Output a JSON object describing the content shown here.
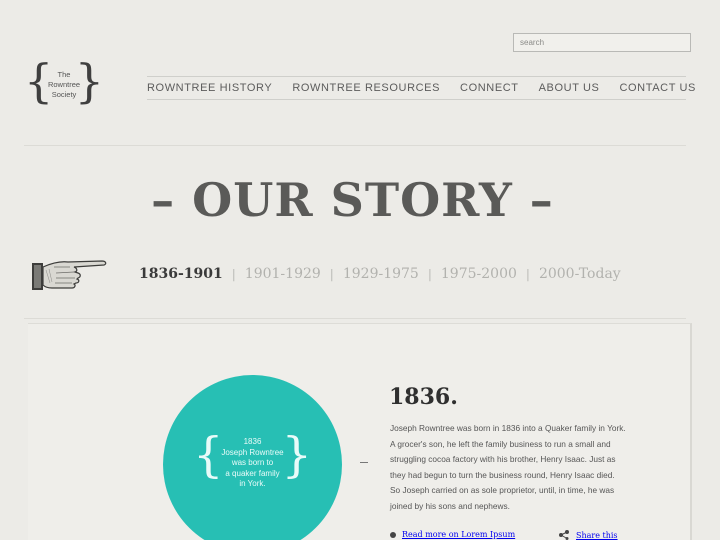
{
  "search": {
    "placeholder": "search"
  },
  "logo": {
    "line1": "The",
    "line2": "Rowntree",
    "line3": "Society",
    "left_brace": "{",
    "right_brace": "}"
  },
  "nav": {
    "items": [
      {
        "label": "ROWNTREE HISTORY"
      },
      {
        "label": "ROWNTREE  RESOURCES"
      },
      {
        "label": "CONNECT"
      },
      {
        "label": "ABOUT US"
      },
      {
        "label": "CONTACT US"
      }
    ]
  },
  "page": {
    "title": "– OUR STORY –"
  },
  "timeline": {
    "eras": [
      {
        "label": "1836-1901",
        "active": true
      },
      {
        "label": "1901-1929",
        "active": false
      },
      {
        "label": "1929-1975",
        "active": false
      },
      {
        "label": "1975-2000",
        "active": false
      },
      {
        "label": "2000-Today",
        "active": false
      }
    ],
    "separator": "|"
  },
  "highlight": {
    "color": "#27bfb4",
    "lines": [
      "1836",
      "Joseph Rowntree",
      "was born to",
      "a quaker family",
      "in York."
    ]
  },
  "entry": {
    "dash": "–",
    "year": "1836.",
    "body": "Joseph Rowntree was born in 1836 into a Quaker family in York. A grocer's son, he left the family business to run a small and struggling cocoa factory with his brother, Henry Isaac. Just as they had begun to turn the business round, Henry Isaac died. So Joseph carried on as sole proprietor, until, in time, he was joined by his sons and nephews.",
    "read_more": "Read more on Lorem Ipsum",
    "share": "Share this"
  },
  "icons": {
    "hand": "pointing-hand-icon",
    "share": "share-icon",
    "bullet": "dot-icon"
  },
  "colors": {
    "background": "#ecebe7",
    "accent": "#27bfb4",
    "text": "#555555"
  }
}
